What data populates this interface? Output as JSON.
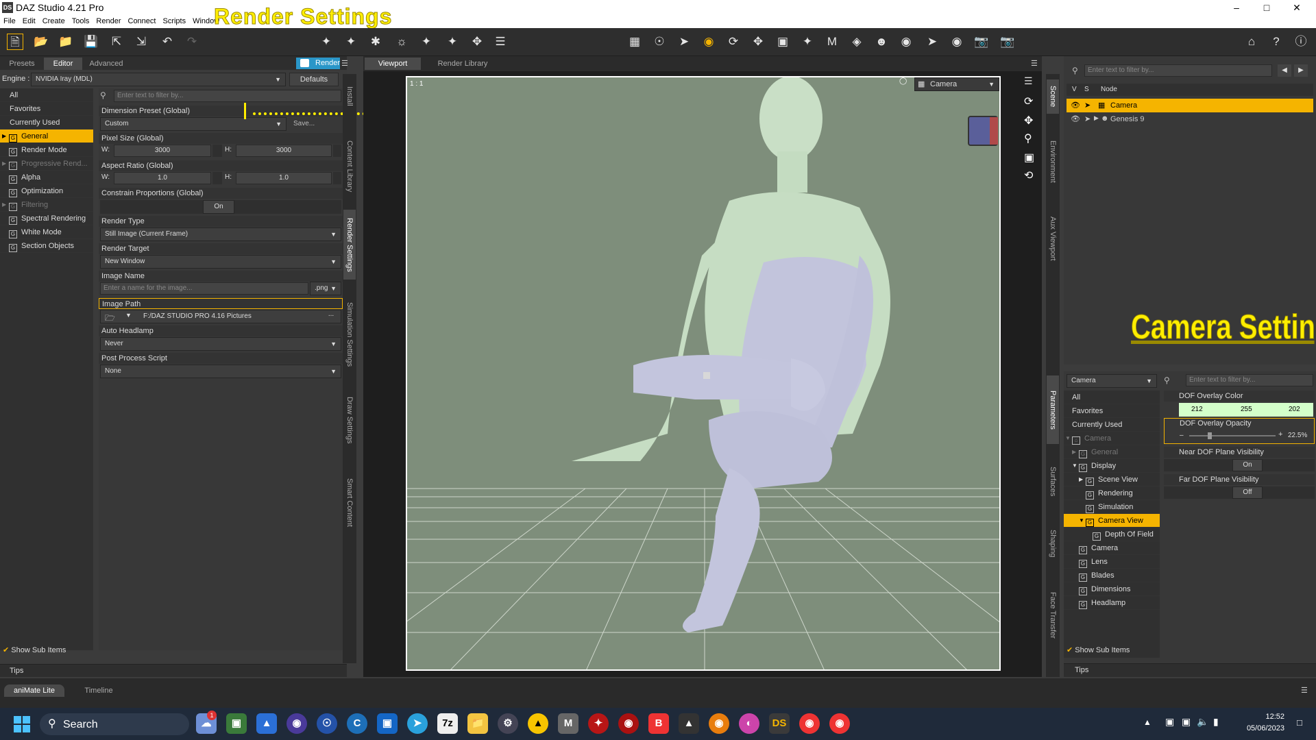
{
  "window": {
    "title": "DAZ Studio 4.21 Pro",
    "logo": "DS"
  },
  "menu": [
    "File",
    "Edit",
    "Create",
    "Tools",
    "Render",
    "Connect",
    "Scripts",
    "Window"
  ],
  "overlays": {
    "render_settings": "Render Settings",
    "camera_settings": "Camera Settings"
  },
  "left_tabs": [
    "Presets",
    "Editor",
    "Advanced"
  ],
  "render_button": "Render",
  "engine": {
    "label": "Engine :",
    "value": "NVIDIA Iray (MDL)",
    "defaults": "Defaults"
  },
  "filter_placeholder": "Enter text to filter by...",
  "left_list": [
    {
      "label": "All",
      "type": "plain"
    },
    {
      "label": "Favorites",
      "type": "plain"
    },
    {
      "label": "Currently Used",
      "type": "plain"
    },
    {
      "label": "General",
      "type": "group",
      "selected": true,
      "expand": true
    },
    {
      "label": "Render Mode",
      "type": "group"
    },
    {
      "label": "Progressive Rend...",
      "type": "group",
      "dim": true,
      "expand": true
    },
    {
      "label": "Alpha",
      "type": "group"
    },
    {
      "label": "Optimization",
      "type": "group"
    },
    {
      "label": "Filtering",
      "type": "group",
      "dim": true,
      "expand": true
    },
    {
      "label": "Spectral Rendering",
      "type": "group"
    },
    {
      "label": "White Mode",
      "type": "group"
    },
    {
      "label": "Section Objects",
      "type": "group"
    }
  ],
  "show_sub_items": "Show Sub Items",
  "tips": "Tips",
  "props": {
    "dimension_preset": {
      "label": "Dimension Preset (Global)",
      "value": "Custom",
      "save": "Save..."
    },
    "pixel_size": {
      "label": "Pixel Size (Global)",
      "w_label": "W:",
      "w": "3000",
      "h_label": "H:",
      "h": "3000"
    },
    "aspect_ratio": {
      "label": "Aspect Ratio (Global)",
      "w_label": "W:",
      "w": "1.0",
      "h_label": "H:",
      "h": "1.0"
    },
    "constrain": {
      "label": "Constrain Proportions (Global)",
      "value": "On"
    },
    "render_type": {
      "label": "Render Type",
      "value": "Still Image (Current Frame)"
    },
    "render_target": {
      "label": "Render Target",
      "value": "New Window"
    },
    "image_name": {
      "label": "Image Name",
      "placeholder": "Enter a name for the image...",
      "ext": ".png"
    },
    "image_path": {
      "label": "Image Path",
      "value": "F:/DAZ STUDIO PRO 4.16 Pictures",
      "browse": "..."
    },
    "auto_headlamp": {
      "label": "Auto Headlamp",
      "value": "Never"
    },
    "post_process": {
      "label": "Post Process Script",
      "value": "None"
    }
  },
  "vtabs_left": [
    "Install",
    "Content Library",
    "Render Settings",
    "Simulation Settings",
    "Draw Settings",
    "Smart Content"
  ],
  "viewport_tabs": [
    "Viewport",
    "Render Library"
  ],
  "viewport": {
    "ratio": "1 : 1",
    "camera": "Camera"
  },
  "scene": {
    "filter_placeholder": "Enter text to filter by...",
    "cols": [
      "V",
      "S",
      "Node"
    ],
    "nodes": [
      {
        "label": "Camera",
        "selected": true
      },
      {
        "label": "Genesis 9",
        "selected": false
      }
    ]
  },
  "vtabs_right": [
    "Scene",
    "Environment",
    "Aux Viewport",
    "Parameters",
    "Surfaces",
    "Shaping",
    "Face Transfer"
  ],
  "params": {
    "node": "Camera",
    "filter_placeholder": "Enter text to filter by...",
    "tree": [
      {
        "label": "All",
        "indent": 0,
        "type": "plain"
      },
      {
        "label": "Favorites",
        "indent": 0,
        "type": "plain"
      },
      {
        "label": "Currently Used",
        "indent": 0,
        "type": "plain"
      },
      {
        "label": "Camera",
        "indent": 0,
        "type": "node",
        "dim": true
      },
      {
        "label": "General",
        "indent": 1,
        "type": "group",
        "dim": true
      },
      {
        "label": "Display",
        "indent": 1,
        "type": "group"
      },
      {
        "label": "Scene View",
        "indent": 2,
        "type": "group"
      },
      {
        "label": "Rendering",
        "indent": 2,
        "type": "group"
      },
      {
        "label": "Simulation",
        "indent": 2,
        "type": "group"
      },
      {
        "label": "Camera View",
        "indent": 2,
        "type": "group",
        "selected": true
      },
      {
        "label": "Depth Of Field",
        "indent": 3,
        "type": "group"
      },
      {
        "label": "Camera",
        "indent": 1,
        "type": "group"
      },
      {
        "label": "Lens",
        "indent": 1,
        "type": "group"
      },
      {
        "label": "Blades",
        "indent": 1,
        "type": "group"
      },
      {
        "label": "Dimensions",
        "indent": 1,
        "type": "group"
      },
      {
        "label": "Headlamp",
        "indent": 1,
        "type": "group"
      }
    ],
    "dof_color": {
      "label": "DOF Overlay Color",
      "r": "212",
      "g": "255",
      "b": "202"
    },
    "dof_opacity": {
      "label": "DOF Overlay Opacity",
      "value": "22.5%",
      "fraction": 0.225
    },
    "near_dof": {
      "label": "Near DOF Plane Visibility",
      "value": "On"
    },
    "far_dof": {
      "label": "Far DOF Plane Visibility",
      "value": "Off"
    }
  },
  "bottom_tabs": [
    "aniMate Lite",
    "Timeline"
  ],
  "taskbar": {
    "search": "Search",
    "time": "12:52",
    "date": "05/06/2023",
    "badge": "1"
  }
}
